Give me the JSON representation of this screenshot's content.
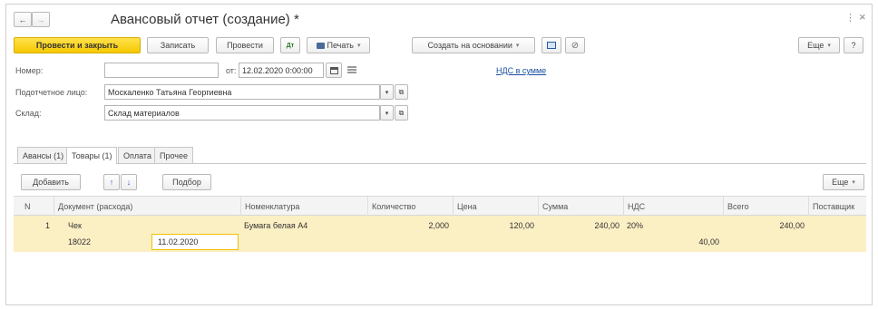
{
  "window": {
    "title": "Авансовый отчет (создание) *",
    "more_icon": "⋮",
    "close_icon": "×"
  },
  "nav": {
    "back": "←",
    "forward": "→"
  },
  "toolbar": {
    "post_close": "Провести и закрыть",
    "save": "Записать",
    "post": "Провести",
    "dt_kt_icon": "Дт/Кт",
    "print": "Печать",
    "create_based": "Создать на основании",
    "more": "Еще",
    "help": "?"
  },
  "form": {
    "number_label": "Номер:",
    "number_value": "",
    "date_from_label": "от:",
    "date_value": "12.02.2020  0:00:00",
    "vat_link": "НДС в сумме",
    "person_label": "Подотчетное лицо:",
    "person_value": "Москаленко Татьяна Георгиевна",
    "warehouse_label": "Склад:",
    "warehouse_value": "Склад материалов"
  },
  "tabs": [
    {
      "label": "Авансы (1)"
    },
    {
      "label": "Товары (1)"
    },
    {
      "label": "Оплата"
    },
    {
      "label": "Прочее"
    }
  ],
  "grid_toolbar": {
    "add": "Добавить",
    "up": "↑",
    "down": "↓",
    "pick": "Подбор",
    "more": "Еще"
  },
  "table": {
    "columns": [
      "N",
      "Документ (расхода)",
      "Номенклатура",
      "Количество",
      "Цена",
      "Сумма",
      "НДС",
      "Всего",
      "Поставщик"
    ],
    "rows": [
      {
        "n": "1",
        "doc": "Чек",
        "doc_number": "18022",
        "doc_date": "11.02.2020",
        "item": "Бумага белая А4",
        "qty": "2,000",
        "price": "120,00",
        "sum": "240,00",
        "vat_rate": "20%",
        "vat_amount": "40,00",
        "total": "240,00",
        "supplier": ""
      }
    ]
  },
  "colors": {
    "primary_button": "#f5c800",
    "row_highlight": "#fbefc4",
    "link": "#1a4fa0"
  }
}
